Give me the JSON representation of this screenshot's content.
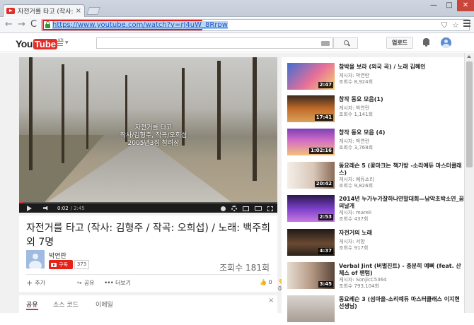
{
  "browser": {
    "tab_title": "자전거를 타고 (작사: 김형",
    "tab_close": "×",
    "url": "https://www.youtube.com/watch?v=rJ4uW_8Rrpw",
    "window_min": "—",
    "window_max": "□",
    "window_close": "✕",
    "nav_back": "←",
    "nav_forward": "→",
    "nav_reload": "C",
    "icons": {
      "favicon": "youtube-favicon",
      "lock": "lock-icon",
      "shield": "shield-icon",
      "star": "star-icon",
      "menu": "hamburger-menu-icon"
    }
  },
  "youtube": {
    "logo_you": "You",
    "logo_tube": "Tube",
    "logo_region": "KR",
    "upload_label": "업로드",
    "icons": {
      "guide": "guide-menu-icon",
      "search": "search-icon",
      "keyboard": "keyboard-icon",
      "notifications": "bell-icon",
      "account": "account-avatar"
    }
  },
  "player": {
    "caption_lines": [
      "자전거를 타고",
      "작사/김형주, 작곡/오희섭",
      "2005년3집 참려상"
    ],
    "time_current": "0:02",
    "time_separator": "/",
    "time_total": "2:45",
    "progress_fraction": 0.015
  },
  "video": {
    "title": "자전거를 타고 (작사: 김형주 / 작곡: 오희섭) / 노래: 백주희 외 7명",
    "channel_name": "박연란",
    "subscribe_label": "구독",
    "subscriber_count": "373",
    "view_count": "조회수 181회",
    "action_add": "추가",
    "action_share": "공유",
    "action_more": "더보기",
    "likes": "0",
    "dislikes": "0"
  },
  "share_panel": {
    "tabs": [
      "공유",
      "소스 코드",
      "이메일"
    ],
    "close": "×"
  },
  "recommendations": [
    {
      "title": "참박을 보라 (외국 곡) / 노래 김혜인",
      "uploader": "게시자: 박연란",
      "views": "조회수 8,924회",
      "duration": "2:47"
    },
    {
      "title": "창작 동요 모음(1)",
      "uploader": "게시자: 박연란",
      "views": "조회수 1,141회",
      "duration": "17:41"
    },
    {
      "title": "창작 동요 모음 (4)",
      "uploader": "게시자: 박연란",
      "views": "조회수 3,768회",
      "duration": "1:02:16"
    },
    {
      "title": "동요레슨 5 (꽃마크는 책가방 -소리예듀 마스터클래스)",
      "uploader": "게시자: 예듀소리",
      "views": "조회수 9,826회",
      "duration": "20:42"
    },
    {
      "title": "2014년 누가누가잘하나연말대회—남악초박소연_꿈의날개",
      "uploader": "게시자: mareli",
      "views": "조회수 437회",
      "duration": "2:53"
    },
    {
      "title": "자전거의 노래",
      "uploader": "게시자: 서항",
      "views": "조회수 917회",
      "duration": "4:37"
    },
    {
      "title": "Verbal Jint (버벌진트) - 충분히 예뻐 (feat. 산체스 of 팬텀)",
      "uploader": "게시자: SonjicC5364",
      "views": "조회수 793,104회",
      "duration": "3:45"
    },
    {
      "title": "동요레슨 3 (섬마을-소리예듀 마스터클래스 이지현선생님)",
      "uploader": "",
      "views": "",
      "duration": ""
    }
  ]
}
